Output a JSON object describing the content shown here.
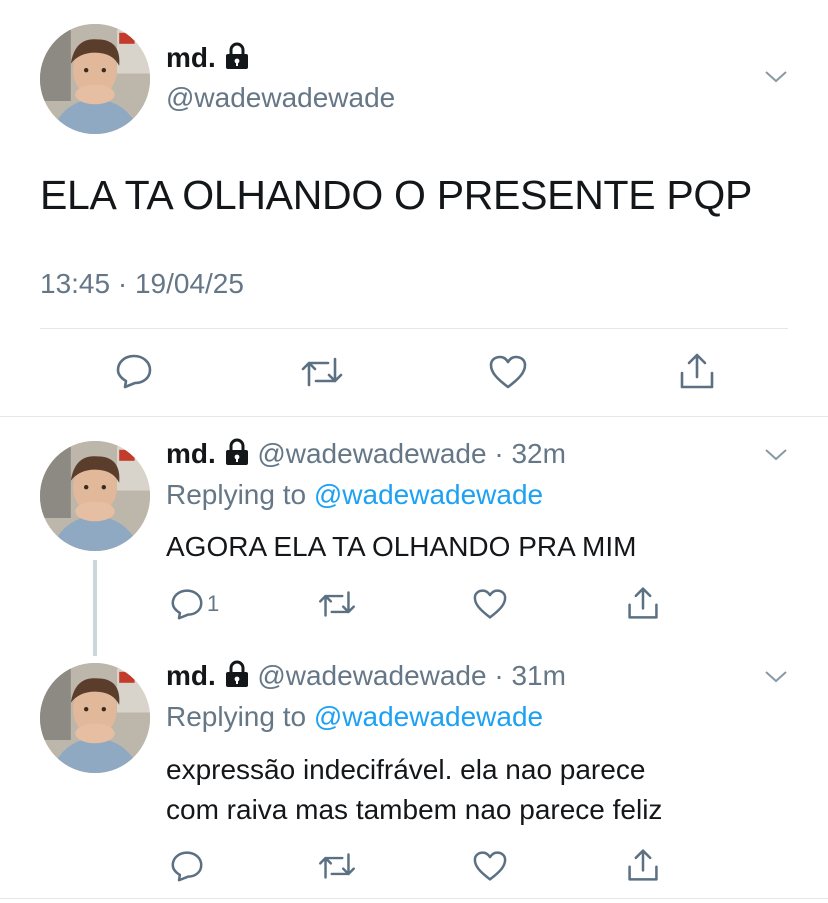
{
  "main_tweet": {
    "display_name": "md.",
    "handle": "@wadewadewade",
    "text": "ELA TA OLHANDO O PRESENTE PQP",
    "timestamp": "13:45 · 19/04/25",
    "actions": [
      "reply-icon",
      "retweet-icon",
      "like-icon",
      "share-icon"
    ]
  },
  "replies": [
    {
      "display_name": "md.",
      "handle": "@wadewadewade",
      "time": "· 32m",
      "replying_prefix": "Replying to",
      "replying_handle": "@wadewadewade",
      "text_lines": [
        "AGORA ELA TA OLHANDO PRA MIM"
      ],
      "reply_count": "1"
    },
    {
      "display_name": "md.",
      "handle": "@wadewadewade",
      "time": "· 31m",
      "replying_prefix": "Replying to",
      "replying_handle": "@wadewadewade",
      "text_lines": [
        "expressão indecifrável. ela nao parece",
        "com raiva mas tambem nao parece feliz"
      ],
      "reply_count": ""
    }
  ],
  "colors": {
    "text": "#14171a",
    "muted": "#657786",
    "link": "#1da1f2",
    "icon": "#5b7083",
    "divider": "#e1e8ed"
  }
}
